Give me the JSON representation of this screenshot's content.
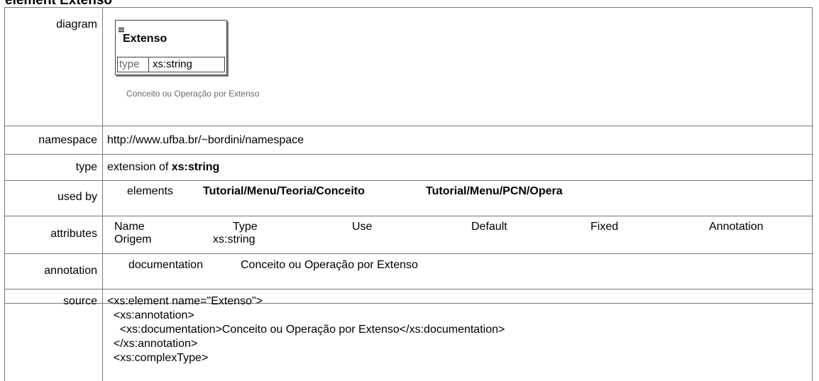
{
  "heading": {
    "prefix": "element",
    "name": "Extenso"
  },
  "rows": {
    "diagram": {
      "label": "diagram",
      "box_title": "Extenso",
      "type_key": "type",
      "type_value": "xs:string",
      "note": "Conceito ou Operação por Extenso"
    },
    "namespace": {
      "label": "namespace",
      "value": "http://www.ufba.br/~bordini/namespace"
    },
    "type": {
      "label": "type",
      "prefix": "extension of",
      "value": "xs:string"
    },
    "used_by": {
      "label": "used by",
      "kind": "elements",
      "links": [
        "Tutorial/Menu/Teoria/Conceito",
        "Tutorial/Menu/PCN/Opera"
      ]
    },
    "attributes": {
      "label": "attributes",
      "headers": [
        "Name",
        "Type",
        "Use",
        "Default",
        "Fixed",
        "Annotation"
      ],
      "rows": [
        [
          "Origem",
          "xs:string",
          "",
          "",
          "",
          ""
        ]
      ]
    },
    "annotation": {
      "label": "annotation",
      "key": "documentation",
      "value": "Conceito ou Operação por Extenso"
    },
    "source": {
      "label": "source",
      "lines": [
        "<xs:element name=\"Extenso\">",
        "  <xs:annotation>",
        "    <xs:documentation>Conceito ou Operação por Extenso</xs:documentation>",
        "  </xs:annotation>",
        "  <xs:complexType>"
      ]
    }
  }
}
